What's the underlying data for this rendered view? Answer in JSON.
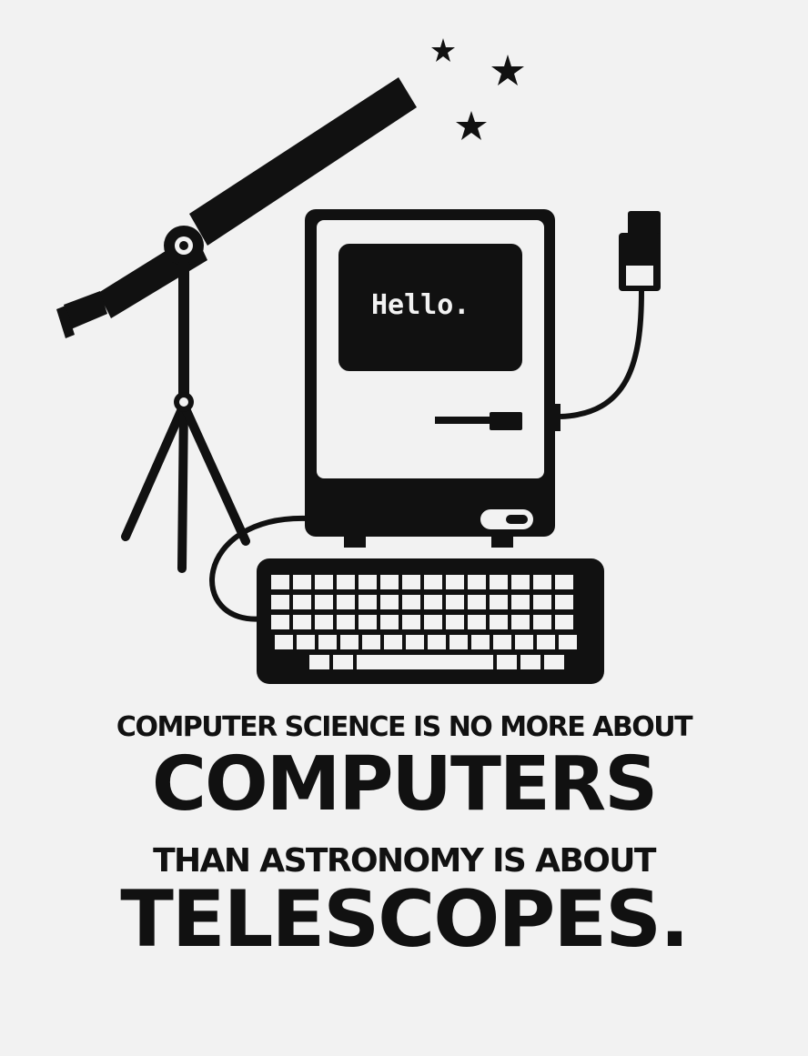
{
  "illustration": {
    "screen_text": "Hello.",
    "icons": [
      "star-icon",
      "telescope-icon",
      "tripod-icon",
      "computer-icon",
      "cable-icon",
      "keyboard-icon"
    ],
    "colors": {
      "background": "#f2f2f2",
      "ink": "#111111",
      "screen_text": "#f2f2f2"
    }
  },
  "quote": {
    "line1": "COMPUTER SCIENCE IS NO MORE ABOUT",
    "line2": "COMPUTERS",
    "line3": "THAN ASTRONOMY IS ABOUT",
    "line4": "TELESCOPES."
  }
}
